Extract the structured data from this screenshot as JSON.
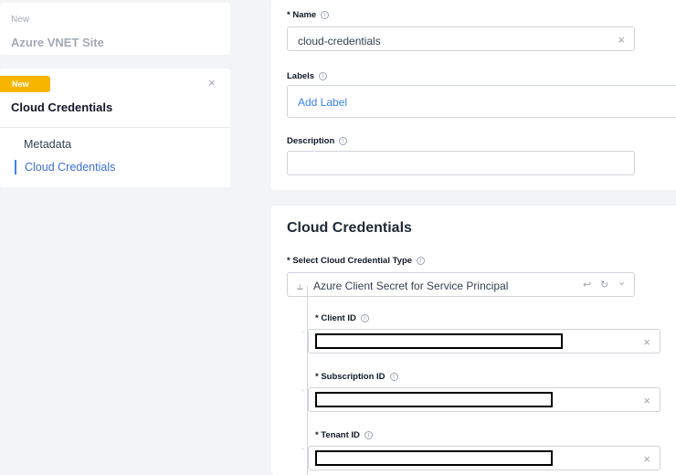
{
  "sidebar": {
    "card1": {
      "small": "New",
      "title": "Azure VNET Site"
    },
    "card2": {
      "badge": "New",
      "close": "×",
      "title": "Cloud Credentials",
      "nav": [
        "Metadata",
        "Cloud Credentials"
      ]
    }
  },
  "form": {
    "name": {
      "label": "* Name",
      "value": "cloud-credentials"
    },
    "labels": {
      "label": "Labels",
      "placeholder": "Add Label"
    },
    "description": {
      "label": "Description",
      "value": ""
    }
  },
  "cloud": {
    "title": "Cloud Credentials",
    "type": {
      "label": "* Select Cloud Credential Type",
      "value": "Azure Client Secret for Service Principal"
    },
    "client_id": {
      "label": "* Client ID"
    },
    "subscription_id": {
      "label": "* Subscription ID"
    },
    "tenant_id": {
      "label": "* Tenant ID"
    }
  },
  "icons": {
    "info": "ⓘ",
    "clear": "×",
    "merge": "⥿",
    "undo": "↩",
    "refresh": "↻",
    "chevron": "⌄"
  },
  "colors": {
    "badge": "#f7b500",
    "accent": "#3b82f6",
    "background": "#f3f4f6"
  }
}
